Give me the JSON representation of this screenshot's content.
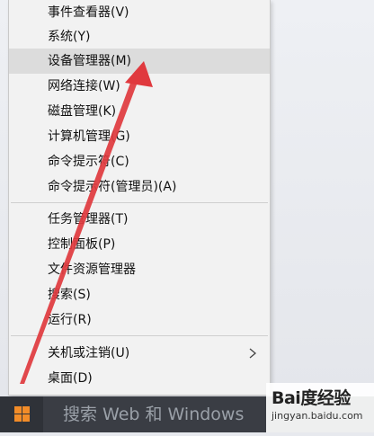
{
  "menu": {
    "items": [
      {
        "label": "事件查看器(V)"
      },
      {
        "label": "系统(Y)"
      },
      {
        "label": "设备管理器(M)"
      },
      {
        "label": "网络连接(W)"
      },
      {
        "label": "磁盘管理(K)"
      },
      {
        "label": "计算机管理(G)"
      },
      {
        "label": "命令提示符(C)"
      },
      {
        "label": "命令提示符(管理员)(A)"
      },
      {
        "label": "任务管理器(T)"
      },
      {
        "label": "控制面板(P)"
      },
      {
        "label": "文件资源管理器"
      },
      {
        "label": "搜索(S)"
      },
      {
        "label": "运行(R)"
      },
      {
        "label": "关机或注销(U)"
      },
      {
        "label": "桌面(D)"
      }
    ],
    "highlighted_item": "设备管理器(M)"
  },
  "taskbar": {
    "search_text": "搜索 Web 和 Windows"
  },
  "watermark": {
    "main": "Bai度经验",
    "sub": "jingyan.baidu.com"
  },
  "colors": {
    "annotation_arrow": "#e0393e",
    "menu_bg": "#f2f2f2",
    "menu_hover": "#dcdcdc",
    "taskbar": "#2f3238"
  },
  "icons": {
    "submenu": "chevron-right-icon",
    "start": "windows-logo-icon"
  }
}
